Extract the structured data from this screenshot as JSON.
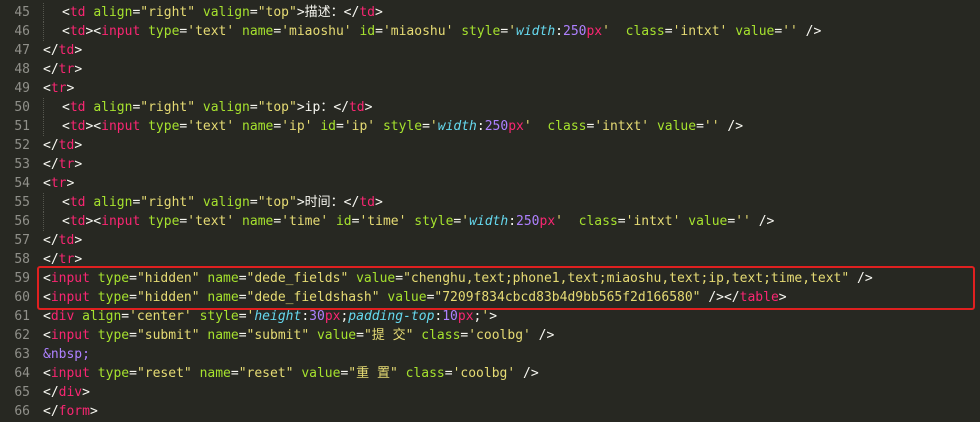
{
  "editor": {
    "lines": [
      {
        "no": "45",
        "indent": 1,
        "tokens": [
          [
            "pun",
            "<"
          ],
          [
            "tag",
            "td"
          ],
          [
            "pun",
            " "
          ],
          [
            "attr",
            "align"
          ],
          [
            "pun",
            "="
          ],
          [
            "str",
            "\"right\""
          ],
          [
            "pun",
            " "
          ],
          [
            "attr",
            "valign"
          ],
          [
            "pun",
            "="
          ],
          [
            "str",
            "\"top\""
          ],
          [
            "pun",
            ">描述：</"
          ],
          [
            "tag",
            "td"
          ],
          [
            "pun",
            ">"
          ]
        ]
      },
      {
        "no": "46",
        "indent": 1,
        "tokens": [
          [
            "pun",
            "<"
          ],
          [
            "tag",
            "td"
          ],
          [
            "pun",
            "><"
          ],
          [
            "tag",
            "input"
          ],
          [
            "pun",
            " "
          ],
          [
            "attr",
            "type"
          ],
          [
            "pun",
            "="
          ],
          [
            "str",
            "'text'"
          ],
          [
            "pun",
            " "
          ],
          [
            "attr",
            "name"
          ],
          [
            "pun",
            "="
          ],
          [
            "str",
            "'miaoshu'"
          ],
          [
            "pun",
            " "
          ],
          [
            "attr",
            "id"
          ],
          [
            "pun",
            "="
          ],
          [
            "str",
            "'miaoshu'"
          ],
          [
            "pun",
            " "
          ],
          [
            "attr",
            "style"
          ],
          [
            "pun",
            "="
          ],
          [
            "str",
            "'"
          ],
          [
            "prop",
            "width"
          ],
          [
            "pun",
            ":"
          ],
          [
            "num",
            "250"
          ],
          [
            "tag",
            "px"
          ],
          [
            "str",
            "'"
          ],
          [
            "pun",
            "  "
          ],
          [
            "attr",
            "class"
          ],
          [
            "pun",
            "="
          ],
          [
            "str",
            "'intxt'"
          ],
          [
            "pun",
            " "
          ],
          [
            "attr",
            "value"
          ],
          [
            "pun",
            "="
          ],
          [
            "str",
            "''"
          ],
          [
            "pun",
            " />"
          ]
        ]
      },
      {
        "no": "47",
        "indent": 0,
        "tokens": [
          [
            "pun",
            "</"
          ],
          [
            "tag",
            "td"
          ],
          [
            "pun",
            ">"
          ]
        ]
      },
      {
        "no": "48",
        "indent": 0,
        "tokens": [
          [
            "pun",
            "</"
          ],
          [
            "tag",
            "tr"
          ],
          [
            "pun",
            ">"
          ]
        ]
      },
      {
        "no": "49",
        "indent": 0,
        "tokens": [
          [
            "pun",
            "<"
          ],
          [
            "tag",
            "tr"
          ],
          [
            "pun",
            ">"
          ]
        ]
      },
      {
        "no": "50",
        "indent": 1,
        "tokens": [
          [
            "pun",
            "<"
          ],
          [
            "tag",
            "td"
          ],
          [
            "pun",
            " "
          ],
          [
            "attr",
            "align"
          ],
          [
            "pun",
            "="
          ],
          [
            "str",
            "\"right\""
          ],
          [
            "pun",
            " "
          ],
          [
            "attr",
            "valign"
          ],
          [
            "pun",
            "="
          ],
          [
            "str",
            "\"top\""
          ],
          [
            "pun",
            ">ip：</"
          ],
          [
            "tag",
            "td"
          ],
          [
            "pun",
            ">"
          ]
        ]
      },
      {
        "no": "51",
        "indent": 1,
        "tokens": [
          [
            "pun",
            "<"
          ],
          [
            "tag",
            "td"
          ],
          [
            "pun",
            "><"
          ],
          [
            "tag",
            "input"
          ],
          [
            "pun",
            " "
          ],
          [
            "attr",
            "type"
          ],
          [
            "pun",
            "="
          ],
          [
            "str",
            "'text'"
          ],
          [
            "pun",
            " "
          ],
          [
            "attr",
            "name"
          ],
          [
            "pun",
            "="
          ],
          [
            "str",
            "'ip'"
          ],
          [
            "pun",
            " "
          ],
          [
            "attr",
            "id"
          ],
          [
            "pun",
            "="
          ],
          [
            "str",
            "'ip'"
          ],
          [
            "pun",
            " "
          ],
          [
            "attr",
            "style"
          ],
          [
            "pun",
            "="
          ],
          [
            "str",
            "'"
          ],
          [
            "prop",
            "width"
          ],
          [
            "pun",
            ":"
          ],
          [
            "num",
            "250"
          ],
          [
            "tag",
            "px"
          ],
          [
            "str",
            "'"
          ],
          [
            "pun",
            "  "
          ],
          [
            "attr",
            "class"
          ],
          [
            "pun",
            "="
          ],
          [
            "str",
            "'intxt'"
          ],
          [
            "pun",
            " "
          ],
          [
            "attr",
            "value"
          ],
          [
            "pun",
            "="
          ],
          [
            "str",
            "''"
          ],
          [
            "pun",
            " />"
          ]
        ]
      },
      {
        "no": "52",
        "indent": 0,
        "tokens": [
          [
            "pun",
            "</"
          ],
          [
            "tag",
            "td"
          ],
          [
            "pun",
            ">"
          ]
        ]
      },
      {
        "no": "53",
        "indent": 0,
        "tokens": [
          [
            "pun",
            "</"
          ],
          [
            "tag",
            "tr"
          ],
          [
            "pun",
            ">"
          ]
        ]
      },
      {
        "no": "54",
        "indent": 0,
        "tokens": [
          [
            "pun",
            "<"
          ],
          [
            "tag",
            "tr"
          ],
          [
            "pun",
            ">"
          ]
        ]
      },
      {
        "no": "55",
        "indent": 1,
        "tokens": [
          [
            "pun",
            "<"
          ],
          [
            "tag",
            "td"
          ],
          [
            "pun",
            " "
          ],
          [
            "attr",
            "align"
          ],
          [
            "pun",
            "="
          ],
          [
            "str",
            "\"right\""
          ],
          [
            "pun",
            " "
          ],
          [
            "attr",
            "valign"
          ],
          [
            "pun",
            "="
          ],
          [
            "str",
            "\"top\""
          ],
          [
            "pun",
            ">时间：</"
          ],
          [
            "tag",
            "td"
          ],
          [
            "pun",
            ">"
          ]
        ]
      },
      {
        "no": "56",
        "indent": 1,
        "tokens": [
          [
            "pun",
            "<"
          ],
          [
            "tag",
            "td"
          ],
          [
            "pun",
            "><"
          ],
          [
            "tag",
            "input"
          ],
          [
            "pun",
            " "
          ],
          [
            "attr",
            "type"
          ],
          [
            "pun",
            "="
          ],
          [
            "str",
            "'text'"
          ],
          [
            "pun",
            " "
          ],
          [
            "attr",
            "name"
          ],
          [
            "pun",
            "="
          ],
          [
            "str",
            "'time'"
          ],
          [
            "pun",
            " "
          ],
          [
            "attr",
            "id"
          ],
          [
            "pun",
            "="
          ],
          [
            "str",
            "'time'"
          ],
          [
            "pun",
            " "
          ],
          [
            "attr",
            "style"
          ],
          [
            "pun",
            "="
          ],
          [
            "str",
            "'"
          ],
          [
            "prop",
            "width"
          ],
          [
            "pun",
            ":"
          ],
          [
            "num",
            "250"
          ],
          [
            "tag",
            "px"
          ],
          [
            "str",
            "'"
          ],
          [
            "pun",
            "  "
          ],
          [
            "attr",
            "class"
          ],
          [
            "pun",
            "="
          ],
          [
            "str",
            "'intxt'"
          ],
          [
            "pun",
            " "
          ],
          [
            "attr",
            "value"
          ],
          [
            "pun",
            "="
          ],
          [
            "str",
            "''"
          ],
          [
            "pun",
            " />"
          ]
        ]
      },
      {
        "no": "57",
        "indent": 0,
        "tokens": [
          [
            "pun",
            "</"
          ],
          [
            "tag",
            "td"
          ],
          [
            "pun",
            ">"
          ]
        ]
      },
      {
        "no": "58",
        "indent": 0,
        "tokens": [
          [
            "pun",
            "</"
          ],
          [
            "tag",
            "tr"
          ],
          [
            "pun",
            ">"
          ]
        ]
      },
      {
        "no": "59",
        "indent": 0,
        "tokens": [
          [
            "pun",
            "<"
          ],
          [
            "tag",
            "input"
          ],
          [
            "pun",
            " "
          ],
          [
            "attr",
            "type"
          ],
          [
            "pun",
            "="
          ],
          [
            "str",
            "\"hidden\""
          ],
          [
            "pun",
            " "
          ],
          [
            "attr",
            "name"
          ],
          [
            "pun",
            "="
          ],
          [
            "str",
            "\"dede_fields\""
          ],
          [
            "pun",
            " "
          ],
          [
            "attr",
            "value"
          ],
          [
            "pun",
            "="
          ],
          [
            "str",
            "\"chenghu,text;phone1,text;miaoshu,text;ip,text;time,text\""
          ],
          [
            "pun",
            " />"
          ]
        ]
      },
      {
        "no": "60",
        "indent": 0,
        "tokens": [
          [
            "pun",
            "<"
          ],
          [
            "tag",
            "input"
          ],
          [
            "pun",
            " "
          ],
          [
            "attr",
            "type"
          ],
          [
            "pun",
            "="
          ],
          [
            "str",
            "\"hidden\""
          ],
          [
            "pun",
            " "
          ],
          [
            "attr",
            "name"
          ],
          [
            "pun",
            "="
          ],
          [
            "str",
            "\"dede_fieldshash\""
          ],
          [
            "pun",
            " "
          ],
          [
            "attr",
            "value"
          ],
          [
            "pun",
            "="
          ],
          [
            "str",
            "\"7209f834cbcd83b4d9bb565f2d166580\""
          ],
          [
            "pun",
            " /></"
          ],
          [
            "tag",
            "table"
          ],
          [
            "pun",
            ">"
          ]
        ]
      },
      {
        "no": "61",
        "indent": 0,
        "tokens": [
          [
            "pun",
            "<"
          ],
          [
            "tag",
            "div"
          ],
          [
            "pun",
            " "
          ],
          [
            "attr",
            "align"
          ],
          [
            "pun",
            "="
          ],
          [
            "str",
            "'center'"
          ],
          [
            "pun",
            " "
          ],
          [
            "attr",
            "style"
          ],
          [
            "pun",
            "="
          ],
          [
            "str",
            "'"
          ],
          [
            "prop",
            "height"
          ],
          [
            "pun",
            ":"
          ],
          [
            "num",
            "30"
          ],
          [
            "tag",
            "px"
          ],
          [
            "pun",
            ";"
          ],
          [
            "prop",
            "padding-top"
          ],
          [
            "pun",
            ":"
          ],
          [
            "num",
            "10"
          ],
          [
            "tag",
            "px"
          ],
          [
            "pun",
            ";"
          ],
          [
            "str",
            "'"
          ],
          [
            "pun",
            ">"
          ]
        ]
      },
      {
        "no": "62",
        "indent": 0,
        "tokens": [
          [
            "pun",
            "<"
          ],
          [
            "tag",
            "input"
          ],
          [
            "pun",
            " "
          ],
          [
            "attr",
            "type"
          ],
          [
            "pun",
            "="
          ],
          [
            "str",
            "\"submit\""
          ],
          [
            "pun",
            " "
          ],
          [
            "attr",
            "name"
          ],
          [
            "pun",
            "="
          ],
          [
            "str",
            "\"submit\""
          ],
          [
            "pun",
            " "
          ],
          [
            "attr",
            "value"
          ],
          [
            "pun",
            "="
          ],
          [
            "str",
            "\"提 交\""
          ],
          [
            "pun",
            " "
          ],
          [
            "attr",
            "class"
          ],
          [
            "pun",
            "="
          ],
          [
            "str",
            "'coolbg'"
          ],
          [
            "pun",
            " />"
          ]
        ]
      },
      {
        "no": "63",
        "indent": 0,
        "tokens": [
          [
            "ent",
            "&nbsp;"
          ]
        ]
      },
      {
        "no": "64",
        "indent": 0,
        "tokens": [
          [
            "pun",
            "<"
          ],
          [
            "tag",
            "input"
          ],
          [
            "pun",
            " "
          ],
          [
            "attr",
            "type"
          ],
          [
            "pun",
            "="
          ],
          [
            "str",
            "\"reset\""
          ],
          [
            "pun",
            " "
          ],
          [
            "attr",
            "name"
          ],
          [
            "pun",
            "="
          ],
          [
            "str",
            "\"reset\""
          ],
          [
            "pun",
            " "
          ],
          [
            "attr",
            "value"
          ],
          [
            "pun",
            "="
          ],
          [
            "str",
            "\"重 置\""
          ],
          [
            "pun",
            " "
          ],
          [
            "attr",
            "class"
          ],
          [
            "pun",
            "="
          ],
          [
            "str",
            "'coolbg'"
          ],
          [
            "pun",
            " />"
          ]
        ]
      },
      {
        "no": "65",
        "indent": 0,
        "tokens": [
          [
            "pun",
            "</"
          ],
          [
            "tag",
            "div"
          ],
          [
            "pun",
            ">"
          ]
        ]
      },
      {
        "no": "66",
        "indent": 0,
        "tokens": [
          [
            "pun",
            "</"
          ],
          [
            "tag",
            "form"
          ],
          [
            "pun",
            ">"
          ]
        ]
      }
    ],
    "highlight": {
      "from": "59",
      "to": "60",
      "color": "#e02020"
    },
    "colors": {
      "background": "#272822",
      "tag": "#f92672",
      "attribute": "#a6e22e",
      "string": "#e6db74",
      "number": "#ae81ff",
      "property": "#66d9ef",
      "gutter": "#90908a"
    }
  }
}
